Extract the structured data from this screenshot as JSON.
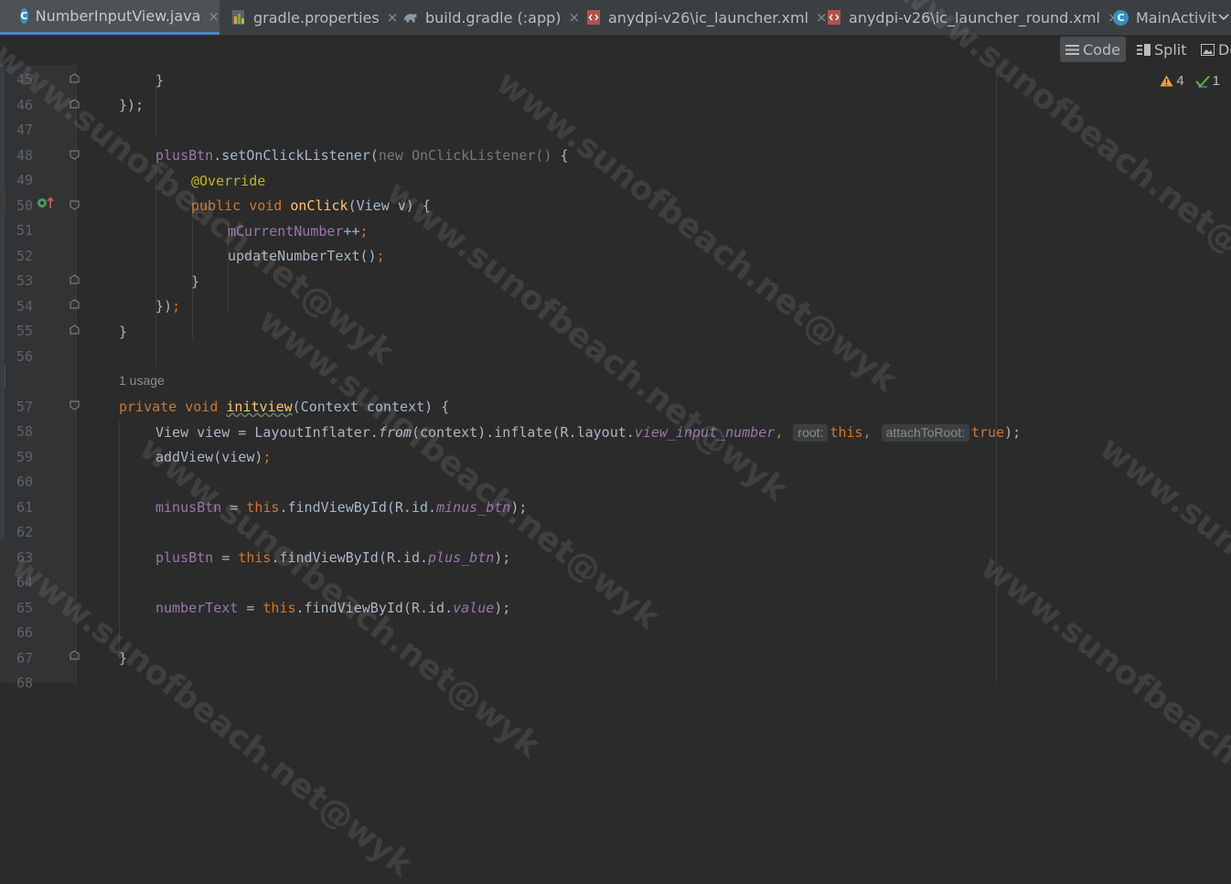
{
  "tabs": [
    {
      "label": "NumberInputView.java",
      "icon": "java-class-icon",
      "active": true
    },
    {
      "label": "gradle.properties",
      "icon": "properties-file-icon",
      "active": false
    },
    {
      "label": "build.gradle (:app)",
      "icon": "gradle-icon",
      "active": false
    },
    {
      "label": "anydpi-v26\\ic_launcher.xml",
      "icon": "xml-file-icon",
      "active": false
    },
    {
      "label": "anydpi-v26\\ic_launcher_round.xml",
      "icon": "xml-file-icon",
      "active": false
    },
    {
      "label": "MainActivit",
      "icon": "java-class-icon",
      "active": false
    }
  ],
  "tab_close_glyph": "×",
  "view_modes": {
    "code": "Code",
    "split": "Split",
    "design": "De"
  },
  "inspection": {
    "warnings": "4",
    "weak_warnings": "1"
  },
  "code": {
    "line_numbers": [
      "45",
      "46",
      "47",
      "48",
      "49",
      "50",
      "51",
      "52",
      "53",
      "54",
      "55",
      "56",
      "57",
      "58",
      "59",
      "60",
      "61",
      "62",
      "63",
      "64",
      "65",
      "66",
      "67",
      "68"
    ],
    "usage_hint": "1 usage",
    "l45": "}",
    "l46_a": "});",
    "l48_var": "plusBtn",
    "l48_call": ".setOnClickListener(",
    "l48_new": "new ",
    "l48_type": "OnClickListener()",
    "l48_brace": " {",
    "l49": "@Override",
    "l50_mods": "public void ",
    "l50_name": "onClick",
    "l50_params": "(View v) {",
    "l51_field": "mCurrentNumber",
    "l51_op": "++",
    "l51_semi": ";",
    "l52_call": "updateNumberText()",
    "l52_semi": ";",
    "l53": "}",
    "l54_a": "})",
    "l54_semi": ";",
    "l55": "}",
    "l57_mods": "private void ",
    "l57_name": "initview",
    "l57_params": "(Context context) {",
    "l58_a": "View view = LayoutInflater.",
    "l58_from": "from",
    "l58_b": "(context).inflate(R.layout.",
    "l58_layout": "view_input_number",
    "l58_comma1": ", ",
    "l58_hint1": "root:",
    "l58_this": "this",
    "l58_comma2": ", ",
    "l58_hint2": "attachToRoot:",
    "l58_true": "true",
    "l58_end": ");",
    "l59_call": "addView(view)",
    "l59_semi": ";",
    "l61_field": "minusBtn",
    "l61_eq": " = ",
    "l61_this": "this",
    "l61_call": ".findViewById(R.id.",
    "l61_id": "minus_btn",
    "l61_end": ");",
    "l63_field": "plusBtn",
    "l63_eq": " = ",
    "l63_this": "this",
    "l63_call": ".findViewById(R.id.",
    "l63_id": "plus_btn",
    "l63_end": ");",
    "l65_field": "numberText",
    "l65_eq": " = ",
    "l65_this": "this",
    "l65_call": ".findViewById(R.id.",
    "l65_id": "value",
    "l65_end": ");",
    "l67": "}"
  },
  "watermark": "www.sunofbeach.net@wyk",
  "colors": {
    "keyword": "#cc7832",
    "method": "#ffc66d",
    "field": "#9876aa",
    "annotation": "#bbb529",
    "text": "#a9b7c6",
    "background": "#2b2b2b",
    "tab_accent": "#4a88c7"
  }
}
